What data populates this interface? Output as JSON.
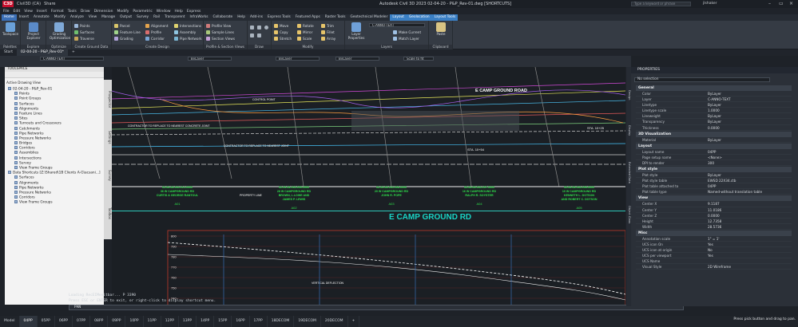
{
  "titlebar": {
    "app_badge": "C3D",
    "quick": [
      "Civil3D (CA)",
      "Share"
    ],
    "title": "Autodesk Civil 3D 2023   02-04-20 - P&P_Rev-01.dwg [SHORTCUTS]",
    "search_placeholder": "Type a keyword or phrase",
    "user": "jlshaker"
  },
  "menubar": [
    "File",
    "Edit",
    "View",
    "Insert",
    "Format",
    "Tools",
    "Draw",
    "Dimension",
    "Modify",
    "Parametric",
    "Window",
    "Help",
    "Express"
  ],
  "ribbon_tabs": [
    "Home",
    "Insert",
    "Annotate",
    "Modify",
    "Analyze",
    "View",
    "Manage",
    "Output",
    "Survey",
    "Rail",
    "Transparent",
    "InfraWorks",
    "Collaborate",
    "Help",
    "Add-ins",
    "Express Tools",
    "Featured Apps",
    "Raster Tools",
    "Geotechnical Modeler",
    "Layout",
    "Geolocation",
    "Layout Tools"
  ],
  "ribbon_active_tab": "Home",
  "ribbon_context_tabs": [
    "Layout",
    "Geolocation",
    "Layout Tools"
  ],
  "ribbon": {
    "palettes": {
      "title": "Palettes",
      "toolspace": "Toolspace"
    },
    "explore": {
      "title": "Explore",
      "project": "Project\nExplorer"
    },
    "optimize": {
      "title": "Optimize",
      "grading": "Grading\nOptimization"
    },
    "ground": {
      "title": "Create Ground Data",
      "items": [
        "Points",
        "Surfaces",
        "Traverse"
      ]
    },
    "design": {
      "title": "Create Design",
      "items": [
        "Parcel",
        "Feature Line",
        "Grading",
        "Alignment",
        "Profile",
        "Corridor",
        "Intersections",
        "Assembly",
        "Pipe Network"
      ]
    },
    "profile": {
      "title": "Profile & Section Views",
      "items": [
        "Profile View",
        "Sample Lines",
        "Section Views"
      ]
    },
    "draw": {
      "title": "Draw"
    },
    "modify": {
      "title": "Modify",
      "items": [
        "Move",
        "Copy",
        "Stretch",
        "Rotate",
        "Mirror",
        "Scale",
        "Trim",
        "Fillet",
        "Array"
      ]
    },
    "layers": {
      "title": "Layers",
      "props": "Layer\nProperties",
      "current": "C-ANNO-TEXT",
      "items": [
        "Make Current",
        "Match Layer"
      ]
    },
    "clipboard": {
      "title": "Clipboard",
      "paste": "Paste"
    }
  },
  "file_tabs": [
    "Start",
    "02-04-20 - P&P_Rev-01*"
  ],
  "layer_toolbar": {
    "layer": "C-ANNO-TEXT",
    "color": "ByLayer",
    "linetype": "ByLayer",
    "lineweight": "ByLayer",
    "scale": "Scale to fit"
  },
  "toolspace": {
    "title": "TOOLSPACE",
    "view": "Active Drawing View",
    "tree": [
      {
        "label": "02-04-20 - P&P_Rev-01",
        "indent": 0
      },
      {
        "label": "Points",
        "indent": 1
      },
      {
        "label": "Point Groups",
        "indent": 1
      },
      {
        "label": "Surfaces",
        "indent": 1
      },
      {
        "label": "Alignments",
        "indent": 1
      },
      {
        "label": "Feature Lines",
        "indent": 1
      },
      {
        "label": "Sites",
        "indent": 1
      },
      {
        "label": "Turnouts and Crossovers",
        "indent": 1
      },
      {
        "label": "Catchments",
        "indent": 1
      },
      {
        "label": "Pipe Networks",
        "indent": 1
      },
      {
        "label": "Pressure Networks",
        "indent": 1
      },
      {
        "label": "Bridges",
        "indent": 1
      },
      {
        "label": "Corridors",
        "indent": 1
      },
      {
        "label": "Assemblies",
        "indent": 1
      },
      {
        "label": "Intersections",
        "indent": 1
      },
      {
        "label": "Survey",
        "indent": 1
      },
      {
        "label": "View Frame Groups",
        "indent": 1
      },
      {
        "label": "Data Shortcuts [Z:\\Shared\\1B Clients A-G\\acsani...]",
        "indent": 0
      },
      {
        "label": "Surfaces",
        "indent": 1
      },
      {
        "label": "Alignments",
        "indent": 1
      },
      {
        "label": "Pipe Networks",
        "indent": 1
      },
      {
        "label": "Pressure Networks",
        "indent": 1
      },
      {
        "label": "Corridors",
        "indent": 1
      },
      {
        "label": "View Frame Groups",
        "indent": 1
      }
    ],
    "side_tabs": [
      "Prospector",
      "Settings",
      "Survey",
      "Toolbox"
    ]
  },
  "drawing": {
    "road_label": "E CAMP GROUND RD",
    "road_label_top": "E CAMP GROUND ROAD",
    "station_labels": [
      "STA. 10+25",
      "STA. 10+54"
    ],
    "parcels": [
      {
        "id": "A01",
        "lines": [
          "02-06-08-034-014-0000",
          "36 W CAMPGROUND RD",
          "CURTIS & GEORGE RANTOUL"
        ]
      },
      {
        "id": "A02",
        "lines": [
          "02-06-08-034-009-0000",
          "28 W CAMPGROUND RD",
          "BROWN, L.LOWE AND",
          "JAMES P. LEWIS"
        ]
      },
      {
        "id": "A03",
        "lines": [
          "02-06-08-034-008-0000",
          "20 W CAMPGROUND RD",
          "JOHN R. POPE"
        ]
      },
      {
        "id": "A04",
        "lines": [
          "02-06-08-034-007-0000",
          "16 W CAMPGROUND RD",
          "RALPH R. SOYSTER"
        ]
      },
      {
        "id": "A05",
        "lines": [
          "02-06-08-034-006-0000",
          "10 W CAMPGROUND RD",
          "KENNETH L. DOTSON",
          "AND ROBERT C. DOTSON"
        ]
      }
    ],
    "profile_values": [
      "800",
      "790",
      "780",
      "770",
      "760",
      "750",
      "740"
    ],
    "annotations": [
      "CONTRACTOR TO REPLACE TO NEAREST CONCRETE JOINT",
      "CONTRACTOR TO REPLACE TO NEAREST JOINT",
      "CONTROL POINT",
      "PROPERTY LINE",
      "VERTICAL DEFLECTION"
    ]
  },
  "command": {
    "lines": [
      "Loading RecEIMenitbar...  P 3390",
      "Press ESC or ENTER to exit, or right-click to display shortcut menu."
    ],
    "input": "PAN"
  },
  "properties": {
    "title": "PROPERTIES",
    "selection": "No selection",
    "side_tabs": [
      "Design",
      "Display",
      "Extended Data",
      "Object Class"
    ],
    "sections": [
      {
        "name": "General",
        "rows": [
          [
            "Color",
            "ByLayer"
          ],
          [
            "Layer",
            "C-ANNO-TEXT"
          ],
          [
            "Linetype",
            "ByLayer"
          ],
          [
            "Linetype scale",
            "1.0000"
          ],
          [
            "Lineweight",
            "ByLayer"
          ],
          [
            "Transparency",
            "ByLayer"
          ],
          [
            "Thickness",
            "0.0000"
          ]
        ]
      },
      {
        "name": "3D Visualization",
        "rows": [
          [
            "Material",
            "ByLayer"
          ]
        ]
      },
      {
        "name": "Layout",
        "rows": [
          [
            "Layout name",
            "04PP"
          ],
          [
            "Page setup name",
            "<None>"
          ],
          [
            "DPI to render",
            "300"
          ]
        ]
      },
      {
        "name": "Plot style",
        "rows": [
          [
            "Plot style",
            "ByLayer"
          ],
          [
            "Plot style table",
            "EWSD 22X34.ctb"
          ],
          [
            "Plot table attached to",
            "04PP"
          ],
          [
            "Plot table type",
            "Named-without translation table"
          ]
        ]
      },
      {
        "name": "View",
        "rows": [
          [
            "Center X",
            "9.1187"
          ],
          [
            "Center Y",
            "11.0186"
          ],
          [
            "Center Z",
            "0.0000"
          ],
          [
            "Height",
            "12.7358"
          ],
          [
            "Width",
            "28.5736"
          ]
        ]
      },
      {
        "name": "Misc",
        "rows": [
          [
            "Annotation scale",
            "1\" = 1'"
          ],
          [
            "UCS icon On",
            "Yes"
          ],
          [
            "UCS icon at origin",
            "No"
          ],
          [
            "UCS per viewport",
            "Yes"
          ],
          [
            "UCS Name",
            ""
          ],
          [
            "Visual Style",
            "2D Wireframe"
          ]
        ]
      }
    ]
  },
  "status": {
    "layout_tabs": [
      "Model",
      "04PP",
      "05PP",
      "06PP",
      "07PP",
      "08PP",
      "09PP",
      "10PP",
      "11PP",
      "12PP",
      "13PP",
      "14PP",
      "15PP",
      "16PP",
      "17PP",
      "18DECOM",
      "19DECOM",
      "20DECOM",
      "+"
    ],
    "active": "04PP",
    "message": "Press pick button and drag to pan."
  },
  "colors": {
    "accent": "#3b6fb6",
    "road_label": "#19d3c5",
    "parcel_text": "#2ee04a",
    "profile_grid": "#c0392b"
  }
}
